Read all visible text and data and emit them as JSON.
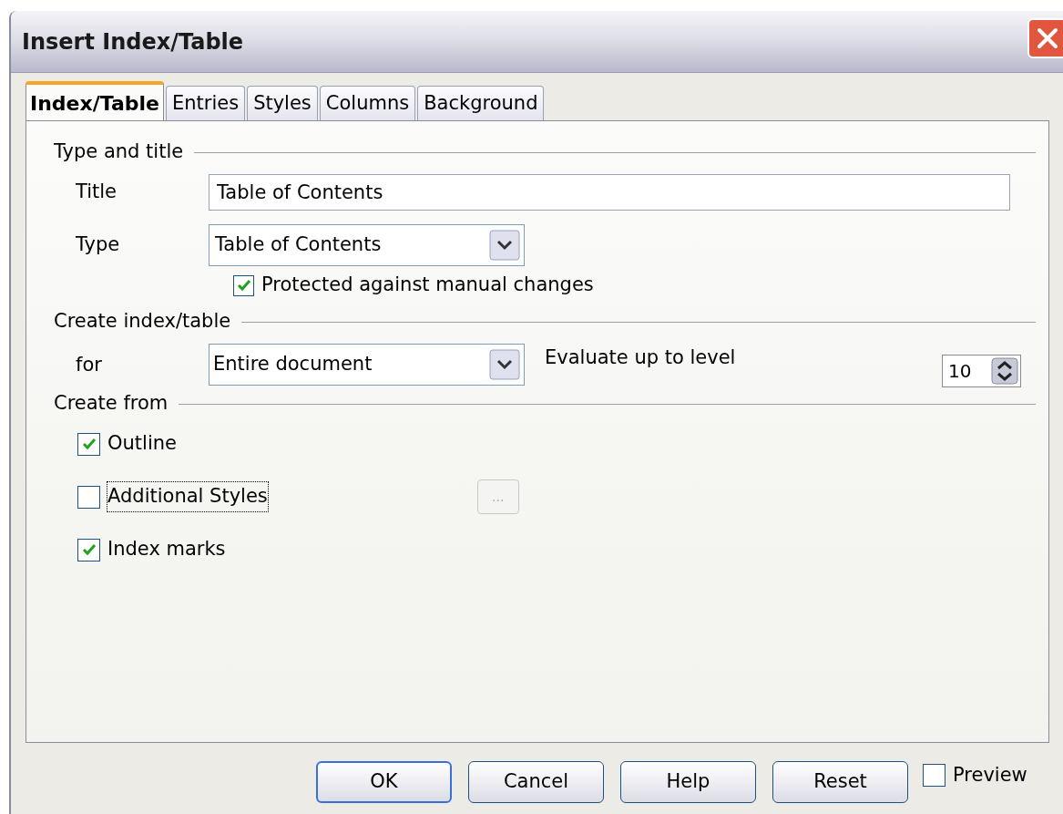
{
  "window": {
    "title": "Insert Index/Table"
  },
  "tabs": [
    {
      "label": "Index/Table",
      "selected": true
    },
    {
      "label": "Entries",
      "selected": false
    },
    {
      "label": "Styles",
      "selected": false
    },
    {
      "label": "Columns",
      "selected": false
    },
    {
      "label": "Background",
      "selected": false
    }
  ],
  "type_and_title": {
    "heading": "Type and title",
    "title_label": "Title",
    "title_value": "Table of Contents",
    "type_label": "Type",
    "type_value": "Table of Contents",
    "protected": {
      "label": "Protected against manual changes",
      "checked": true
    }
  },
  "create_index": {
    "heading": "Create index/table",
    "for_label": "for",
    "for_value": "Entire document",
    "level_label": "Evaluate up to level",
    "level_value": "10"
  },
  "create_from": {
    "heading": "Create from",
    "options": [
      {
        "label": "Outline",
        "checked": true,
        "focused": false
      },
      {
        "label": "Additional Styles",
        "checked": false,
        "focused": true
      },
      {
        "label": "Index marks",
        "checked": true,
        "focused": false
      }
    ],
    "styles_button": {
      "label": "...",
      "disabled": true
    }
  },
  "buttons": [
    {
      "label": "OK",
      "default": true
    },
    {
      "label": "Cancel",
      "default": false
    },
    {
      "label": "Help",
      "default": false
    },
    {
      "label": "Reset",
      "default": false
    }
  ],
  "preview": {
    "label": "Preview",
    "checked": false
  }
}
